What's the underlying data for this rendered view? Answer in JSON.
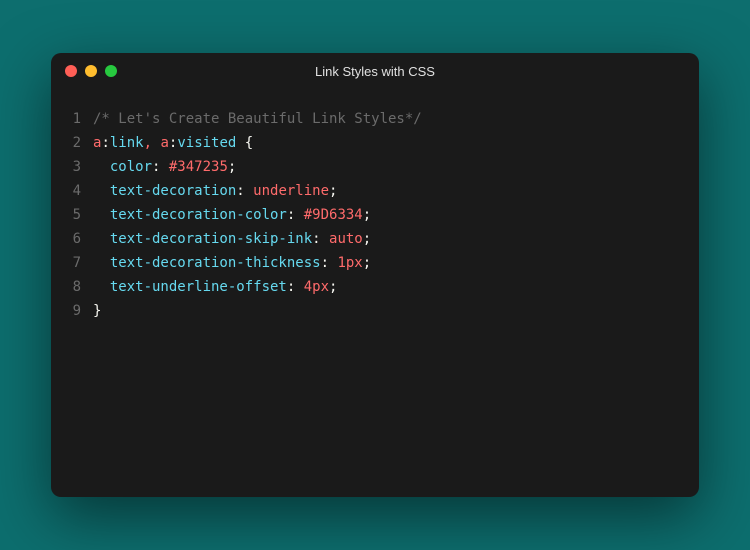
{
  "window": {
    "title": "Link Styles with CSS",
    "traffic_lights": {
      "close": "red",
      "minimize": "yellow",
      "zoom": "green"
    }
  },
  "syntax_colors": {
    "comment": "#6b6b6b",
    "selector": "#ff6b6b",
    "pseudo": "#66d9ef",
    "punctuation": "#f8f8f2",
    "property": "#66d9ef",
    "value_hex": "#ff6b6b",
    "value_keyword": "#ff6b6b",
    "value_number": "#ff6b6b"
  },
  "code": {
    "lines": [
      {
        "n": 1,
        "tokens": [
          {
            "t": "/* Let's Create Beautiful Link Styles*/",
            "c": "comment"
          }
        ]
      },
      {
        "n": 2,
        "tokens": [
          {
            "t": "a",
            "c": "selector"
          },
          {
            "t": ":",
            "c": "punct"
          },
          {
            "t": "link",
            "c": "pseudo"
          },
          {
            "t": ",",
            "c": "selector"
          },
          {
            "t": " ",
            "c": "punct"
          },
          {
            "t": "a",
            "c": "selector"
          },
          {
            "t": ":",
            "c": "punct"
          },
          {
            "t": "visited",
            "c": "pseudo"
          },
          {
            "t": " {",
            "c": "punct"
          }
        ]
      },
      {
        "n": 3,
        "tokens": [
          {
            "t": "  ",
            "c": "punct"
          },
          {
            "t": "color",
            "c": "prop"
          },
          {
            "t": ": ",
            "c": "punct"
          },
          {
            "t": "#347235",
            "c": "val-hex"
          },
          {
            "t": ";",
            "c": "punct"
          }
        ]
      },
      {
        "n": 4,
        "tokens": [
          {
            "t": "  ",
            "c": "punct"
          },
          {
            "t": "text-decoration",
            "c": "prop"
          },
          {
            "t": ": ",
            "c": "punct"
          },
          {
            "t": "underline",
            "c": "val-keyword"
          },
          {
            "t": ";",
            "c": "punct"
          }
        ]
      },
      {
        "n": 5,
        "tokens": [
          {
            "t": "  ",
            "c": "punct"
          },
          {
            "t": "text-decoration-color",
            "c": "prop"
          },
          {
            "t": ": ",
            "c": "punct"
          },
          {
            "t": "#9D6334",
            "c": "val-hex"
          },
          {
            "t": ";",
            "c": "punct"
          }
        ]
      },
      {
        "n": 6,
        "tokens": [
          {
            "t": "  ",
            "c": "punct"
          },
          {
            "t": "text-decoration-skip-ink",
            "c": "prop"
          },
          {
            "t": ": ",
            "c": "punct"
          },
          {
            "t": "auto",
            "c": "val-keyword"
          },
          {
            "t": ";",
            "c": "punct"
          }
        ]
      },
      {
        "n": 7,
        "tokens": [
          {
            "t": "  ",
            "c": "punct"
          },
          {
            "t": "text-decoration-thickness",
            "c": "prop"
          },
          {
            "t": ": ",
            "c": "punct"
          },
          {
            "t": "1px",
            "c": "val-num"
          },
          {
            "t": ";",
            "c": "punct"
          }
        ]
      },
      {
        "n": 8,
        "tokens": [
          {
            "t": "  ",
            "c": "punct"
          },
          {
            "t": "text-underline-offset",
            "c": "prop"
          },
          {
            "t": ": ",
            "c": "punct"
          },
          {
            "t": "4px",
            "c": "val-num"
          },
          {
            "t": ";",
            "c": "punct"
          }
        ]
      },
      {
        "n": 9,
        "tokens": [
          {
            "t": "}",
            "c": "punct"
          }
        ]
      }
    ]
  }
}
